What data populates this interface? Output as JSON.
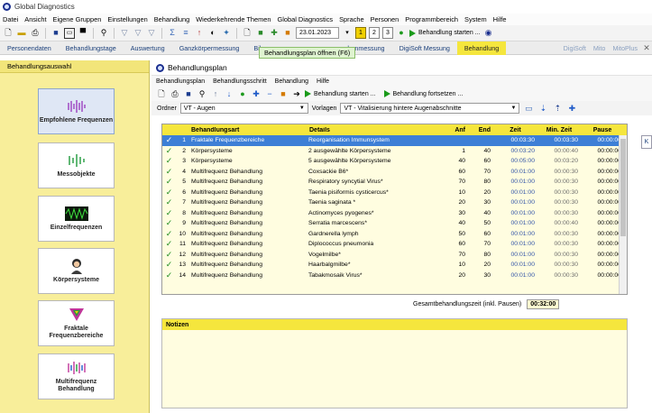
{
  "window": {
    "title": "Global Diagnostics"
  },
  "menubar": [
    "Datei",
    "Ansicht",
    "Eigene Gruppen",
    "Einstellungen",
    "Behandlung",
    "Wiederkehrende Themen",
    "Global Diagnostics",
    "Sprache",
    "Personen",
    "Programmbereich",
    "System",
    "Hilfe"
  ],
  "toolbar": {
    "date": "23.01.2023",
    "numbers": [
      "1",
      "2",
      "3"
    ],
    "start_label": "Behandlung starten ..."
  },
  "tabs": [
    {
      "label": "Personendaten",
      "active": false
    },
    {
      "label": "Behandlungstage",
      "active": false
    },
    {
      "label": "Auswertung",
      "active": false
    },
    {
      "label": "Ganzkörpermessung",
      "active": false
    },
    {
      "label": "Bil",
      "active": false
    },
    {
      "label": "nbenmessung",
      "active": false
    },
    {
      "label": "DigiSoft Messung",
      "active": false
    },
    {
      "label": "Behandlung",
      "active": true
    }
  ],
  "tabs_right": [
    "DigiSoft",
    "Mito",
    "MitoPlus"
  ],
  "tooltip": "Behandlungsplan öffnen (F6)",
  "sidebar": {
    "title": "Behandlungsauswahl",
    "items": [
      {
        "label": "Empfohlene Frequenzen",
        "icon": "frequency-bars-icon",
        "selected": true
      },
      {
        "label": "Messobjekte",
        "icon": "green-bars-icon",
        "selected": false
      },
      {
        "label": "Einzelfrequenzen",
        "icon": "oscilloscope-icon",
        "selected": false
      },
      {
        "label": "Körpersysteme",
        "icon": "person-icon",
        "selected": false
      },
      {
        "label": "Fraktale Frequenzbereiche",
        "icon": "triangle-fractal-icon",
        "selected": false
      },
      {
        "label": "Multifrequenz Behandlung",
        "icon": "multi-bars-icon",
        "selected": false
      }
    ]
  },
  "panel": {
    "title": "Behandlungsplan",
    "menu": [
      "Behandlungsplan",
      "Behandlungsschritt",
      "Behandlung",
      "Hilfe"
    ],
    "start_label": "Behandlung starten ...",
    "continue_label": "Behandlung fortsetzen ...",
    "ordner_label": "Ordner",
    "ordner_value": "VT - Augen",
    "vorlagen_label": "Vorlagen",
    "vorlagen_value": "VT - Vitalisierung hintere Augenabschnitte"
  },
  "table": {
    "columns": [
      "Behandlungsart",
      "Details",
      "Anf",
      "End",
      "Zeit",
      "Min. Zeit",
      "Pause"
    ],
    "rows": [
      {
        "n": "1",
        "art": "Fraktale Frequenzbereiche",
        "det": "Reorganisation Immunsystem",
        "anf": "",
        "end": "",
        "zeit": "00:03:30",
        "min": "00:03:30",
        "pause": "00:00:00",
        "sel": true
      },
      {
        "n": "2",
        "art": "Körpersysteme",
        "det": "2 ausgewählte Körpersysteme",
        "anf": "1",
        "end": "40",
        "zeit": "00:03:20",
        "min": "00:00:40",
        "pause": "00:00:00",
        "sel": false
      },
      {
        "n": "3",
        "art": "Körpersysteme",
        "det": "5 ausgewählte Körpersysteme",
        "anf": "40",
        "end": "60",
        "zeit": "00:05:00",
        "min": "00:03:20",
        "pause": "00:00:00",
        "sel": false
      },
      {
        "n": "4",
        "art": "Multifrequenz Behandlung",
        "det": "Coxsackie B6*",
        "anf": "60",
        "end": "70",
        "zeit": "00:01:00",
        "min": "00:00:30",
        "pause": "00:00:00",
        "sel": false
      },
      {
        "n": "5",
        "art": "Multifrequenz Behandlung",
        "det": "Respiratory syncytial Virus*",
        "anf": "70",
        "end": "80",
        "zeit": "00:01:00",
        "min": "00:00:30",
        "pause": "00:00:00",
        "sel": false
      },
      {
        "n": "6",
        "art": "Multifrequenz Behandlung",
        "det": "Taenia pisiformis cysticercus*",
        "anf": "10",
        "end": "20",
        "zeit": "00:01:00",
        "min": "00:00:30",
        "pause": "00:00:00",
        "sel": false
      },
      {
        "n": "7",
        "art": "Multifrequenz Behandlung",
        "det": "Taenia saginata *",
        "anf": "20",
        "end": "30",
        "zeit": "00:01:00",
        "min": "00:00:30",
        "pause": "00:00:00",
        "sel": false
      },
      {
        "n": "8",
        "art": "Multifrequenz Behandlung",
        "det": "Actinomyces pyogenes*",
        "anf": "30",
        "end": "40",
        "zeit": "00:01:00",
        "min": "00:00:30",
        "pause": "00:00:00",
        "sel": false
      },
      {
        "n": "9",
        "art": "Multifrequenz Behandlung",
        "det": "Serratia marcescens*",
        "anf": "40",
        "end": "50",
        "zeit": "00:01:00",
        "min": "00:00:40",
        "pause": "00:00:00",
        "sel": false
      },
      {
        "n": "10",
        "art": "Multifrequenz Behandlung",
        "det": "Gardnerella lymph",
        "anf": "50",
        "end": "60",
        "zeit": "00:01:00",
        "min": "00:00:30",
        "pause": "00:00:00",
        "sel": false
      },
      {
        "n": "11",
        "art": "Multifrequenz Behandlung",
        "det": "Diplococcus pneumonia",
        "anf": "60",
        "end": "70",
        "zeit": "00:01:00",
        "min": "00:00:30",
        "pause": "00:00:00",
        "sel": false
      },
      {
        "n": "12",
        "art": "Multifrequenz Behandlung",
        "det": "Vogelmilbe*",
        "anf": "70",
        "end": "80",
        "zeit": "00:01:00",
        "min": "00:00:30",
        "pause": "00:00:00",
        "sel": false
      },
      {
        "n": "13",
        "art": "Multifrequenz Behandlung",
        "det": "Haarbalgmilbe*",
        "anf": "10",
        "end": "20",
        "zeit": "00:01:00",
        "min": "00:00:30",
        "pause": "00:00:00",
        "sel": false
      },
      {
        "n": "14",
        "art": "Multifrequenz Behandlung",
        "det": "Tabakmosaik Virus*",
        "anf": "20",
        "end": "30",
        "zeit": "00:01:00",
        "min": "00:00:30",
        "pause": "00:00:00",
        "sel": false
      }
    ]
  },
  "total": {
    "label": "Gesamtbehandlungszeit (inkl. Pausen)",
    "value": "00:32:00"
  },
  "notes": {
    "title": "Notizen"
  },
  "right_edge": "K"
}
